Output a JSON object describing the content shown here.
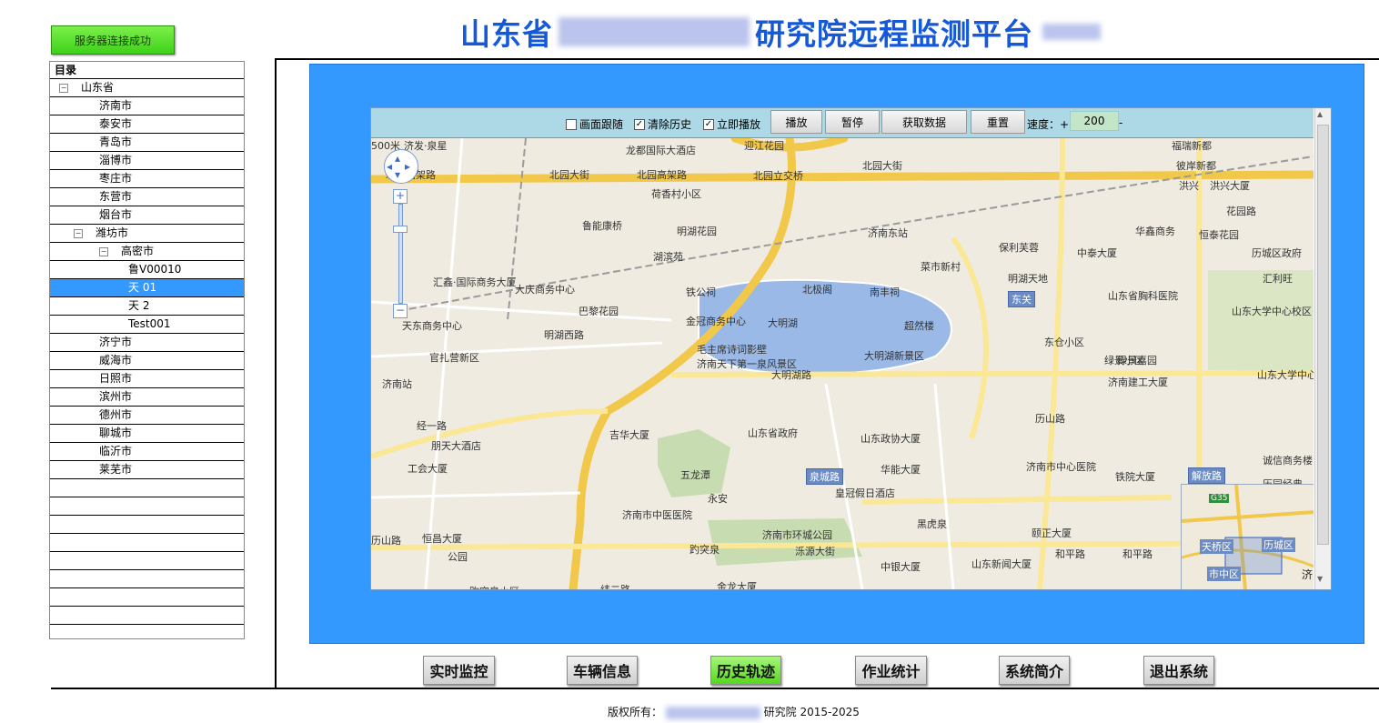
{
  "header": {
    "status_button": "服务器连接成功",
    "title_prefix": "山东省",
    "title_suffix": "研究院远程监测平台"
  },
  "tree": {
    "heading": "目录",
    "rows": [
      {
        "label": "山东省",
        "indent": 0,
        "toggle": "⊟"
      },
      {
        "label": "济南市",
        "indent": 2
      },
      {
        "label": "泰安市",
        "indent": 2
      },
      {
        "label": "青岛市",
        "indent": 2
      },
      {
        "label": "淄博市",
        "indent": 2
      },
      {
        "label": "枣庄市",
        "indent": 2
      },
      {
        "label": "东营市",
        "indent": 2
      },
      {
        "label": "烟台市",
        "indent": 2
      },
      {
        "label": "潍坊市",
        "indent": 1,
        "toggle": "⊟"
      },
      {
        "label": "高密市",
        "indent": 2,
        "toggle": "⊟"
      },
      {
        "label": "鲁V00010",
        "indent": 3
      },
      {
        "label": "天          01",
        "indent": 3,
        "selected": true
      },
      {
        "label": "天          2",
        "indent": 3
      },
      {
        "label": "Test001",
        "indent": 3
      },
      {
        "label": "济宁市",
        "indent": 2
      },
      {
        "label": "威海市",
        "indent": 2
      },
      {
        "label": "日照市",
        "indent": 2
      },
      {
        "label": "滨州市",
        "indent": 2
      },
      {
        "label": "德州市",
        "indent": 2
      },
      {
        "label": "聊城市",
        "indent": 2
      },
      {
        "label": "临沂市",
        "indent": 2
      },
      {
        "label": "莱芜市",
        "indent": 2
      }
    ]
  },
  "toolbar": {
    "follow_label": "画面跟随",
    "follow_checked": false,
    "clear_label": "清除历史",
    "clear_checked": true,
    "instant_label": "立即播放",
    "instant_checked": true,
    "play": "播放",
    "pause": "暂停",
    "fetch": "获取数据",
    "reset": "重置",
    "speed_label": "速度：+",
    "speed_value": "200",
    "speed_minus": "-"
  },
  "map": {
    "labels": [
      "济发·泉星",
      "龙都国际大酒店",
      "迎江花园",
      "福瑞新都",
      "北园高架路",
      "北园大街",
      "北园高架路",
      "北园立交桥",
      "北园大街",
      "荷香村小区",
      "洪兴",
      "洪兴大厦",
      "彼岸新都",
      "鲁能康桥",
      "明湖花园",
      "济南东站",
      "华鑫商务",
      "恒泰花园",
      "花园路",
      "湖滨苑",
      "保利芙蓉",
      "中泰大厦",
      "历城区政府",
      "汇鑫·国际商务大厦",
      "大庆商务中心",
      "铁公祠",
      "北极阁",
      "南丰祠",
      "菜市新村",
      "明湖天地",
      "汇利旺",
      "巴黎花园",
      "金冠商务中心",
      "大明湖",
      "超然楼",
      "东关",
      "山东省胸科医院",
      "山东大学中心校区",
      "天东商务中心",
      "毛主席诗词影壁",
      "大明湖新景区",
      "东仓小区",
      "绿景小区",
      "官扎营新区",
      "济南天下第一泉风景区",
      "大明湖路",
      "绿景嘉园",
      "济南建工大厦",
      "山东大学中心校区",
      "济南站",
      "经一路",
      "吉华大厦",
      "山东省政府",
      "山东政协大厦",
      "历山路",
      "朋天大酒店",
      "工会大厦",
      "五龙潭",
      "华能大厦",
      "济南市中心医院",
      "诚信商务楼",
      "泉城路",
      "铁院大厦",
      "解放路",
      "历园经典",
      "永安",
      "皇冠假日酒店",
      "济南市中医医院",
      "济南市环城公园",
      "黑虎泉",
      "明湖西路",
      "趵突泉",
      "泺源大街",
      "颐正大厦",
      "和平路",
      "和平路",
      "恒昌大厦",
      "中银大厦",
      "山东新闻大厦",
      "历山路",
      "公园",
      "纬二路",
      "金龙大厦",
      "趵突泉小区",
      "500米"
    ],
    "inset_labels": [
      "G35",
      "天桥区",
      "历城区",
      "市中区",
      "济"
    ],
    "zoom_plus": "+",
    "zoom_minus": "−"
  },
  "nav": {
    "realtime": "实时监控",
    "vehicle": "车辆信息",
    "history": "历史轨迹",
    "stats": "作业统计",
    "intro": "系统简介",
    "exit": "退出系统"
  },
  "footer": {
    "prefix": "版权所有：",
    "suffix": "研究院 2015-2025"
  },
  "colors": {
    "title": "#1459d9",
    "panel": "#3399ff",
    "toolbar": "#add8e6",
    "selected_row": "#3399ff",
    "active_nav": "#56d81f"
  }
}
